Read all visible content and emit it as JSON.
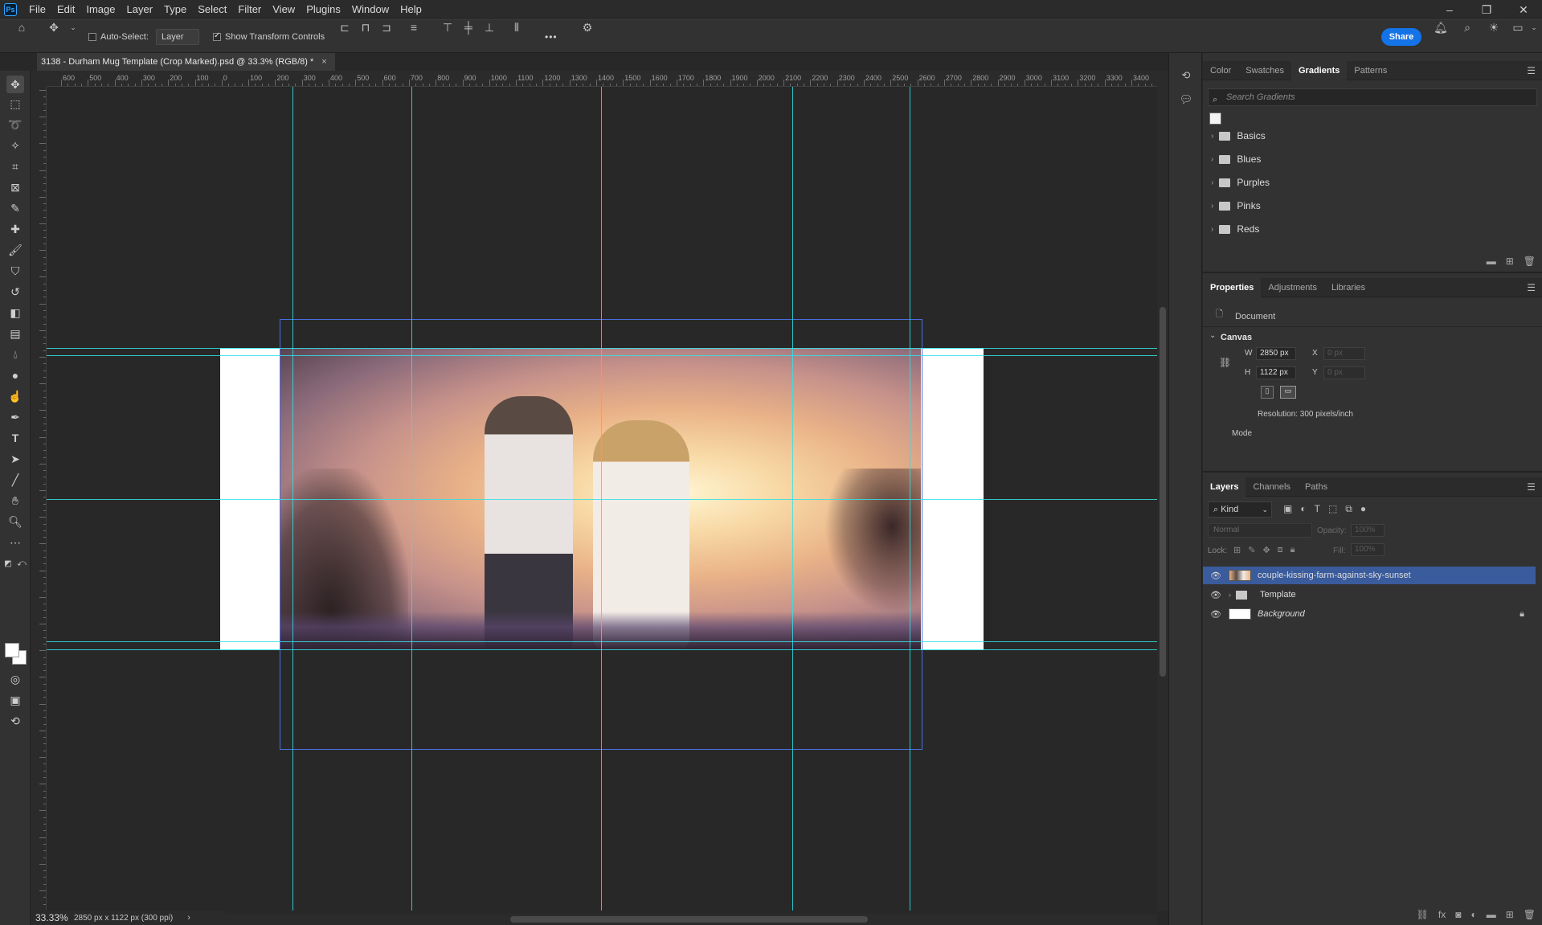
{
  "app": {
    "logo": "Ps"
  },
  "menu": [
    "File",
    "Edit",
    "Image",
    "Layer",
    "Type",
    "Select",
    "Filter",
    "View",
    "Plugins",
    "Window",
    "Help"
  ],
  "window_controls": {
    "minimize": "–",
    "restore": "❐",
    "close": "✕"
  },
  "options_bar": {
    "auto_select_label": "Auto-Select:",
    "auto_select_checked": false,
    "layer_select_value": "Layer",
    "show_transform_label": "Show Transform Controls",
    "show_transform_checked": true,
    "more_label": "•••",
    "share_label": "Share"
  },
  "document_tab": {
    "title": "3138 - Durham Mug Template (Crop Marked).psd @ 33.3% (RGB/8) *",
    "close": "×"
  },
  "ruler": {
    "h_labels": [
      "600",
      "500",
      "400",
      "300",
      "200",
      "100",
      "0",
      "100",
      "200",
      "300",
      "400",
      "500",
      "600",
      "700",
      "800",
      "900",
      "1000",
      "1100",
      "1200",
      "1300",
      "1400",
      "1500",
      "1600",
      "1700",
      "1800",
      "1900",
      "2000",
      "2100",
      "2200",
      "2300",
      "2400",
      "2500",
      "2600",
      "2700",
      "2800",
      "2900",
      "3000",
      "3100",
      "3200",
      "3300",
      "3400"
    ]
  },
  "status": {
    "zoom": "33.33%",
    "doc_size": "2850 px x 1122 px (300 ppi)",
    "arrow": "›"
  },
  "gradients_panel": {
    "tabs": [
      "Color",
      "Swatches",
      "Gradients",
      "Patterns"
    ],
    "active_tab": "Gradients",
    "search_placeholder": "Search Gradients",
    "folders": [
      "Basics",
      "Blues",
      "Purples",
      "Pinks",
      "Reds"
    ]
  },
  "properties_panel": {
    "tabs": [
      "Properties",
      "Adjustments",
      "Libraries"
    ],
    "active_tab": "Properties",
    "doc_label": "Document",
    "section": "Canvas",
    "w_label": "W",
    "w_value": "2850 px",
    "h_label": "H",
    "h_value": "1122 px",
    "x_label": "X",
    "x_value": "0 px",
    "y_label": "Y",
    "y_value": "0 px",
    "resolution": "Resolution: 300 pixels/inch",
    "mode_label": "Mode"
  },
  "layers_panel": {
    "tabs": [
      "Layers",
      "Channels",
      "Paths"
    ],
    "active_tab": "Layers",
    "kind_label": "Kind",
    "blend_mode": "Normal",
    "opacity_label": "Opacity:",
    "opacity_value": "100%",
    "lock_label": "Lock:",
    "fill_label": "Fill:",
    "fill_value": "100%",
    "layers": [
      {
        "name": "couple-kissing-farm-against-sky-sunset",
        "selected": true,
        "type": "smart-object"
      },
      {
        "name": "Template",
        "selected": false,
        "type": "group"
      },
      {
        "name": "Background",
        "selected": false,
        "type": "background",
        "locked": true
      }
    ]
  },
  "colors": {
    "accent": "#1473e6",
    "guide": "#32e0e8",
    "selection": "#3a5b9c",
    "transform_box": "#4a6fe0"
  }
}
